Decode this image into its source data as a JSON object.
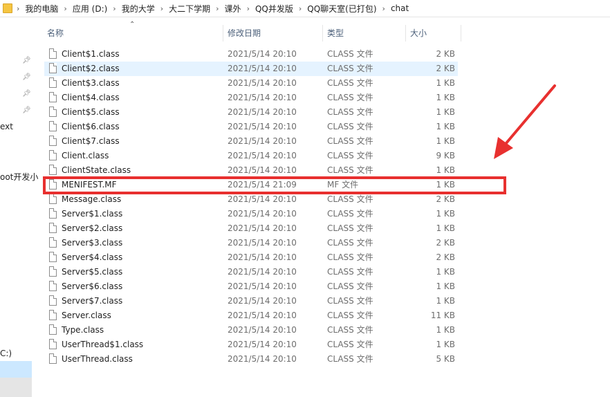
{
  "address_bar": {
    "crumbs": [
      "我的电脑",
      "应用 (D:)",
      "我的大学",
      "大二下学期",
      "课外",
      "QQ并发版",
      "QQ聊天室(已打包)",
      "chat"
    ]
  },
  "nav_pane": {
    "items": [
      "ext",
      "oot开发小",
      "C:)"
    ]
  },
  "columns": {
    "name": "名称",
    "date": "修改日期",
    "type": "类型",
    "size": "大小"
  },
  "files": [
    {
      "name": "Client$1.class",
      "date": "2021/5/14 20:10",
      "type": "CLASS 文件",
      "size": "2 KB"
    },
    {
      "name": "Client$2.class",
      "date": "2021/5/14 20:10",
      "type": "CLASS 文件",
      "size": "2 KB"
    },
    {
      "name": "Client$3.class",
      "date": "2021/5/14 20:10",
      "type": "CLASS 文件",
      "size": "1 KB"
    },
    {
      "name": "Client$4.class",
      "date": "2021/5/14 20:10",
      "type": "CLASS 文件",
      "size": "1 KB"
    },
    {
      "name": "Client$5.class",
      "date": "2021/5/14 20:10",
      "type": "CLASS 文件",
      "size": "1 KB"
    },
    {
      "name": "Client$6.class",
      "date": "2021/5/14 20:10",
      "type": "CLASS 文件",
      "size": "1 KB"
    },
    {
      "name": "Client$7.class",
      "date": "2021/5/14 20:10",
      "type": "CLASS 文件",
      "size": "1 KB"
    },
    {
      "name": "Client.class",
      "date": "2021/5/14 20:10",
      "type": "CLASS 文件",
      "size": "9 KB"
    },
    {
      "name": "ClientState.class",
      "date": "2021/5/14 20:10",
      "type": "CLASS 文件",
      "size": "1 KB"
    },
    {
      "name": "MENIFEST.MF",
      "date": "2021/5/14 21:09",
      "type": "MF 文件",
      "size": "1 KB"
    },
    {
      "name": "Message.class",
      "date": "2021/5/14 20:10",
      "type": "CLASS 文件",
      "size": "2 KB"
    },
    {
      "name": "Server$1.class",
      "date": "2021/5/14 20:10",
      "type": "CLASS 文件",
      "size": "1 KB"
    },
    {
      "name": "Server$2.class",
      "date": "2021/5/14 20:10",
      "type": "CLASS 文件",
      "size": "1 KB"
    },
    {
      "name": "Server$3.class",
      "date": "2021/5/14 20:10",
      "type": "CLASS 文件",
      "size": "2 KB"
    },
    {
      "name": "Server$4.class",
      "date": "2021/5/14 20:10",
      "type": "CLASS 文件",
      "size": "2 KB"
    },
    {
      "name": "Server$5.class",
      "date": "2021/5/14 20:10",
      "type": "CLASS 文件",
      "size": "1 KB"
    },
    {
      "name": "Server$6.class",
      "date": "2021/5/14 20:10",
      "type": "CLASS 文件",
      "size": "1 KB"
    },
    {
      "name": "Server$7.class",
      "date": "2021/5/14 20:10",
      "type": "CLASS 文件",
      "size": "1 KB"
    },
    {
      "name": "Server.class",
      "date": "2021/5/14 20:10",
      "type": "CLASS 文件",
      "size": "11 KB"
    },
    {
      "name": "Type.class",
      "date": "2021/5/14 20:10",
      "type": "CLASS 文件",
      "size": "1 KB"
    },
    {
      "name": "UserThread$1.class",
      "date": "2021/5/14 20:10",
      "type": "CLASS 文件",
      "size": "1 KB"
    },
    {
      "name": "UserThread.class",
      "date": "2021/5/14 20:10",
      "type": "CLASS 文件",
      "size": "5 KB"
    }
  ],
  "selected_index": 1,
  "colors": {
    "annotation_red": "#e8302f",
    "selection_bg": "#e5f3ff",
    "header_text": "#4c607a"
  }
}
